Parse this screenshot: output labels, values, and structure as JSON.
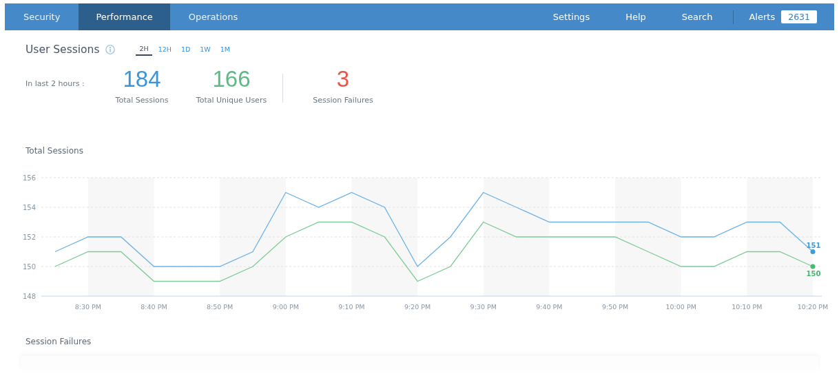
{
  "nav": {
    "tabs": [
      {
        "label": "Security",
        "selected": false
      },
      {
        "label": "Performance",
        "selected": true
      },
      {
        "label": "Operations",
        "selected": false
      }
    ],
    "links": [
      "Settings",
      "Help",
      "Search"
    ],
    "alerts": {
      "label": "Alerts",
      "count": "2631"
    }
  },
  "header": {
    "title": "User Sessions",
    "ranges": [
      {
        "label": "2H",
        "selected": true
      },
      {
        "label": "12H",
        "selected": false
      },
      {
        "label": "1D",
        "selected": false
      },
      {
        "label": "1W",
        "selected": false
      },
      {
        "label": "1M",
        "selected": false
      }
    ]
  },
  "summary": {
    "period": "In last 2 hours :",
    "stats": [
      {
        "value": "184",
        "label": "Total Sessions",
        "color": "#3a95dd"
      },
      {
        "value": "166",
        "label": "Total Unique Users",
        "color": "#5cbb83"
      },
      {
        "value": "3",
        "label": "Session Failures",
        "color": "#e8574a"
      }
    ]
  },
  "sessions_chart": {
    "title": "Total Sessions",
    "chart_data": {
      "type": "line",
      "categories": [
        null,
        "8:30 PM",
        null,
        "8:40 PM",
        null,
        "8:50 PM",
        null,
        "9:00 PM",
        null,
        "9:10 PM",
        null,
        "9:20 PM",
        null,
        "9:30 PM",
        null,
        "9:40 PM",
        null,
        "9:50 PM",
        null,
        "10:00 PM",
        null,
        "10:10 PM",
        null,
        "10:20 PM"
      ],
      "grid": true,
      "series": [
        {
          "color": "#6cb2e6",
          "values": [
            151,
            152,
            152,
            150,
            150,
            150,
            151,
            155,
            154,
            155,
            154,
            150,
            152,
            155,
            154,
            153,
            153,
            153,
            153,
            152,
            152,
            153,
            153,
            151
          ]
        },
        {
          "color": "#7ccb97",
          "values": [
            150,
            151,
            151,
            149,
            149,
            149,
            150,
            152,
            153,
            153,
            152,
            149,
            150,
            153,
            152,
            152,
            152,
            152,
            151,
            150,
            150,
            151,
            151,
            150
          ]
        }
      ],
      "ylim": [
        148,
        156
      ],
      "yticks": [
        148,
        150,
        152,
        154,
        156
      ],
      "annotations": [
        {
          "text": "151",
          "x": "10:20 PM",
          "y": 151
        },
        {
          "text": "150",
          "x": "10:20 PM",
          "y": 150
        }
      ]
    }
  },
  "failures_section": {
    "title": "Session Failures"
  }
}
